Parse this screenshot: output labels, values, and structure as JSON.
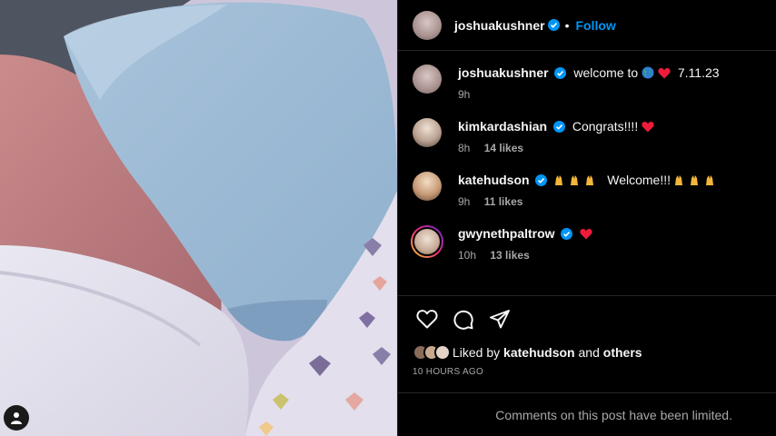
{
  "post": {
    "author": "joshuakushner",
    "follow_label": "Follow",
    "dot": "•",
    "caption": {
      "username": "joshuakushner",
      "text_before": "welcome to",
      "emoji_globe": "globe-icon",
      "emoji_heart": "red-heart-icon",
      "text_after": "7.11.23",
      "time": "9h"
    },
    "comments": [
      {
        "username": "kimkardashian",
        "text": "Congrats!!!!",
        "trailing_emoji": "red-heart-icon",
        "time": "8h",
        "likes": "14 likes"
      },
      {
        "username": "katehudson",
        "pre_emoji": "raising-hands-icon x3",
        "text": "Welcome!!!",
        "trailing_emoji": "raising-hands-icon x3",
        "time": "9h",
        "likes": "11 likes"
      },
      {
        "username": "gwynethpaltrow",
        "text": "",
        "trailing_emoji": "red-heart-icon",
        "time": "10h",
        "likes": "13 likes"
      }
    ],
    "liked_by": {
      "prefix": "Liked by",
      "user": "katehudson",
      "and": "and",
      "others": "others"
    },
    "time_ago": "10 HOURS AGO",
    "comments_limited": "Comments on this post have been limited."
  },
  "colors": {
    "accent": "#0095f6",
    "verified": "#0095f6",
    "heart": "#ed1c3a",
    "background": "#000000",
    "muted": "#a8a8a8"
  }
}
